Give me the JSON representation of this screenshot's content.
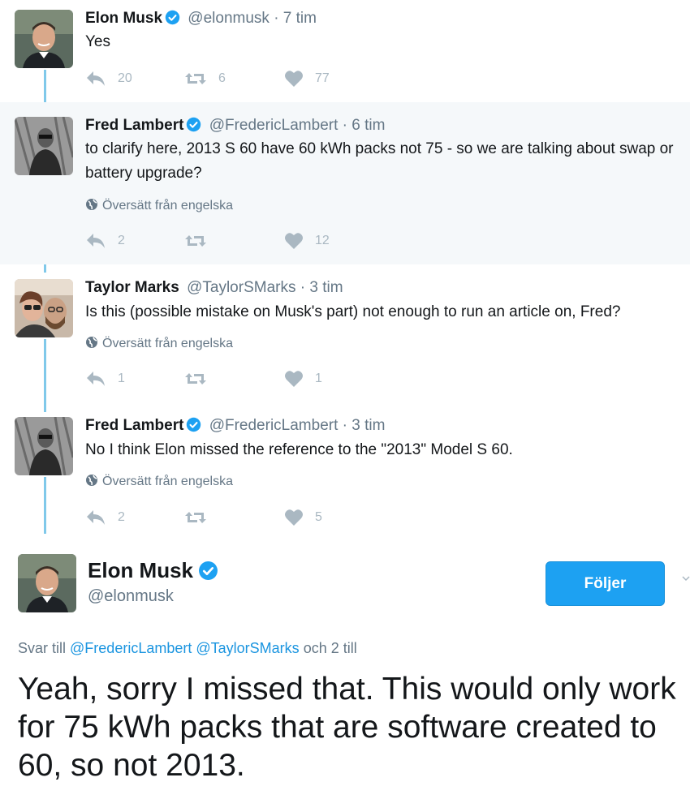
{
  "thread": [
    {
      "name": "Elon Musk",
      "verified": true,
      "handle": "@elonmusk",
      "separator": "·",
      "time": "7 tim",
      "text": "Yes",
      "translate": "",
      "replies": "20",
      "retweets": "6",
      "likes": "77",
      "avatar": "elon-avatar"
    },
    {
      "name": "Fred Lambert",
      "verified": true,
      "handle": "@FredericLambert",
      "separator": "·",
      "time": "6 tim",
      "text": "to clarify here, 2013 S 60 have 60 kWh packs not 75 - so we are talking about swap or battery upgrade?",
      "translate": "Översätt från engelska",
      "replies": "2",
      "retweets": "",
      "likes": "12",
      "avatar": "fred-avatar"
    },
    {
      "name": "Taylor Marks",
      "verified": false,
      "handle": "@TaylorSMarks",
      "separator": "·",
      "time": "3 tim",
      "text": "Is this (possible mistake on Musk's part) not enough to run an article on, Fred?",
      "translate": "Översätt från engelska",
      "replies": "1",
      "retweets": "",
      "likes": "1",
      "avatar": "taylor-avatar"
    },
    {
      "name": "Fred Lambert",
      "verified": true,
      "handle": "@FredericLambert",
      "separator": "·",
      "time": "3 tim",
      "text": "No I think Elon missed the reference to the \"2013\" Model S 60.",
      "translate": "Översätt från engelska",
      "replies": "2",
      "retweets": "",
      "likes": "5",
      "avatar": "fred-avatar"
    }
  ],
  "main": {
    "name": "Elon Musk",
    "handle": "@elonmusk",
    "follow_label": "Följer",
    "reply_prefix": "Svar till",
    "reply_user1": "@FredericLambert",
    "reply_user2": "@TaylorSMarks",
    "reply_suffix": "och 2 till",
    "text": "Yeah, sorry I missed that. This would only work for 75 kWh packs that are software created to 60, so not 2013."
  },
  "colors": {
    "accent": "#1da1f2",
    "link": "#1b95e0",
    "thread_line": "#80c9ea",
    "highlight_bg": "#f5f8fa",
    "muted": "#657786",
    "icon": "#aab8c2"
  },
  "icons": {
    "reply": "reply-icon",
    "retweet": "retweet-icon",
    "like": "heart-icon",
    "verified": "verified-badge-icon",
    "globe": "globe-icon",
    "caret": "chevron-down-icon"
  }
}
